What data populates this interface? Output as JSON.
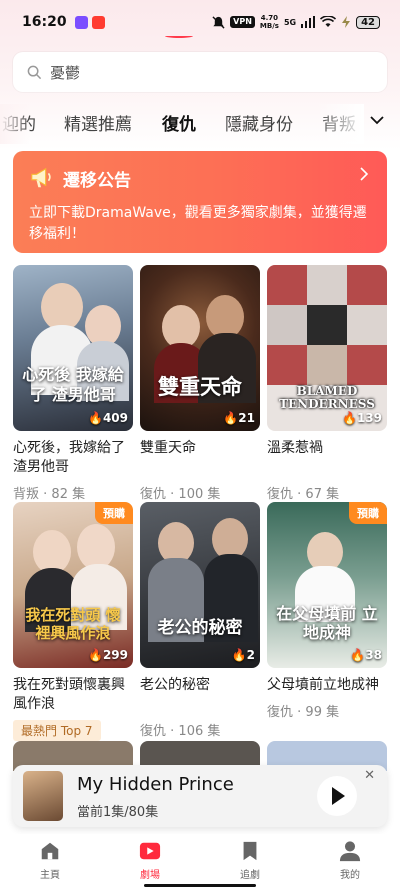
{
  "status_bar": {
    "time": "16:20",
    "vpn": "VPN",
    "speed_value": "4.70",
    "speed_unit": "MB/s",
    "network": "5G",
    "battery": "42"
  },
  "search": {
    "query": "憂鬱"
  },
  "tabs": {
    "items": [
      "迎的",
      "精選推薦",
      "復仇",
      "隱藏身份",
      "背叛"
    ],
    "active_index": 2
  },
  "notice": {
    "title": "遷移公告",
    "body": "立即下載DramaWave，觀看更多獨家劇集，並獲得遷移福利！"
  },
  "dramas": [
    {
      "title": "心死後，我嫁給了渣男他哥",
      "poster_text": "心死後 我嫁給了 渣男他哥",
      "tag": "背叛",
      "episodes": "82 集",
      "count": "409",
      "badge": "",
      "hot": ""
    },
    {
      "title": "雙重天命",
      "poster_text": "雙重天命",
      "tag": "復仇",
      "episodes": "100 集",
      "count": "21",
      "badge": "",
      "hot": ""
    },
    {
      "title": "溫柔惹禍",
      "poster_text": "BLAMED TENDERNESS",
      "tag": "復仇",
      "episodes": "67 集",
      "count": "139",
      "badge": "",
      "hot": ""
    },
    {
      "title": "我在死對頭懷裏興風作浪",
      "poster_text": "我在死對頭 懷裡興風作浪",
      "tag": "",
      "episodes": "",
      "count": "299",
      "badge": "預購",
      "hot": "最熱門 Top 7"
    },
    {
      "title": "老公的秘密",
      "poster_text": "老公的秘密",
      "tag": "復仇",
      "episodes": "106 集",
      "count": "2",
      "badge": "",
      "hot": ""
    },
    {
      "title": "父母墳前立地成神",
      "poster_text": "在父母墳前 立地成神",
      "tag": "復仇",
      "episodes": "99 集",
      "count": "38",
      "badge": "預購",
      "hot": ""
    }
  ],
  "player": {
    "title": "My Hidden Prince",
    "episode": "當前1集/80集"
  },
  "nav": {
    "items": [
      "主頁",
      "劇場",
      "追劇",
      "我的"
    ],
    "active_index": 1
  },
  "colors": {
    "accent": "#ff2a3d",
    "notice_start": "#fb7e56",
    "notice_end": "#ff5a57",
    "badge": "#ff8a1f"
  },
  "icons": [
    "search-icon",
    "megaphone-icon",
    "chevron-down-icon",
    "chevron-right-icon",
    "play-icon",
    "close-icon",
    "home-icon",
    "theater-icon",
    "bookmark-icon",
    "profile-icon"
  ]
}
